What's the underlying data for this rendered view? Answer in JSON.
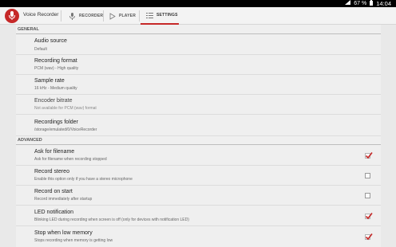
{
  "statusbar": {
    "battery": "67 %",
    "time": "14:04"
  },
  "app": {
    "title": "Voice Recorder",
    "accent": "#c62828"
  },
  "tabs": [
    {
      "label": "RECORDER",
      "icon": "mic-icon"
    },
    {
      "label": "PLAYER",
      "icon": "play-icon"
    },
    {
      "label": "SETTINGS",
      "icon": "settings-list-icon",
      "active": true
    }
  ],
  "general": {
    "header": "GENERAL",
    "items": [
      {
        "title": "Audio source",
        "summary": "Default"
      },
      {
        "title": "Recording format",
        "summary": "PCM (wav) - High quality"
      },
      {
        "title": "Sample rate",
        "summary": "16 kHz - Medium quality"
      },
      {
        "title": "Encoder bitrate",
        "summary": "Not available for PCM (wav) format"
      },
      {
        "title": "Recordings folder",
        "summary": "/storage/emulated/0/VoiceRecorder"
      }
    ]
  },
  "advanced": {
    "header": "ADVANCED",
    "items": [
      {
        "title": "Ask for filename",
        "summary": "Ask for filename when recording stopped",
        "checked": true
      },
      {
        "title": "Record stereo",
        "summary": "Enable this option only if you have a stereo microphone",
        "checked": false
      },
      {
        "title": "Record on start",
        "summary": "Record immediately after startup",
        "checked": false
      },
      {
        "title": "LED notification",
        "summary": "Blinking LED during recording when screen is off (only for devices with notification LED)",
        "checked": true
      },
      {
        "title": "Stop when low memory",
        "summary": "Stops recording when memory is getting low",
        "checked": true
      }
    ]
  }
}
